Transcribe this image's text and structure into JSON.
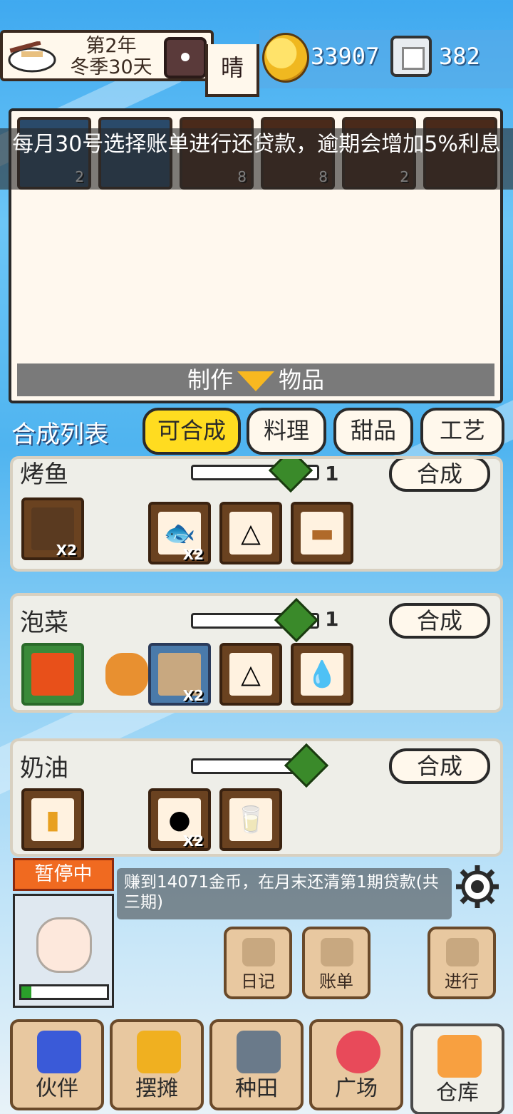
{
  "header": {
    "year": "第2年",
    "season_day": "冬季30天",
    "weather": "晴",
    "coins": "33907",
    "gems": "382"
  },
  "panel": {
    "slot_counts": [
      "2",
      "",
      "8",
      "8",
      "2",
      ""
    ],
    "tip": "每月30号选择账单进行还贷款，逾期会增加5%利息",
    "make_left": "制作",
    "make_right": "物品"
  },
  "tabs": {
    "title": "合成列表",
    "items": [
      "可合成",
      "料理",
      "甜品",
      "工艺"
    ]
  },
  "recipes": [
    {
      "name": "烤鱼",
      "qty": "1",
      "craft": "合成",
      "out_mult": "X2",
      "ing_mult": "X2",
      "level": 0.78
    },
    {
      "name": "泡菜",
      "qty": "1",
      "craft": "合成",
      "ing_mult": "X2",
      "level": 0.82
    },
    {
      "name": "奶油",
      "qty": "",
      "craft": "合成",
      "ing_mult": "X2",
      "level": 0.9
    }
  ],
  "status": {
    "paused": "暂停中",
    "task": "赚到14071金币，在月末还清第1期贷款(共三期)",
    "energy": 0.12
  },
  "actions": {
    "diary": "日记",
    "bill": "账单",
    "proceed": "进行"
  },
  "nav": [
    "伙伴",
    "摆摊",
    "种田",
    "广场",
    "仓库"
  ],
  "icons": {
    "coin": "coin-icon",
    "gem": "gem-icon",
    "clock": "clock-icon",
    "settings": "gear-icon"
  }
}
